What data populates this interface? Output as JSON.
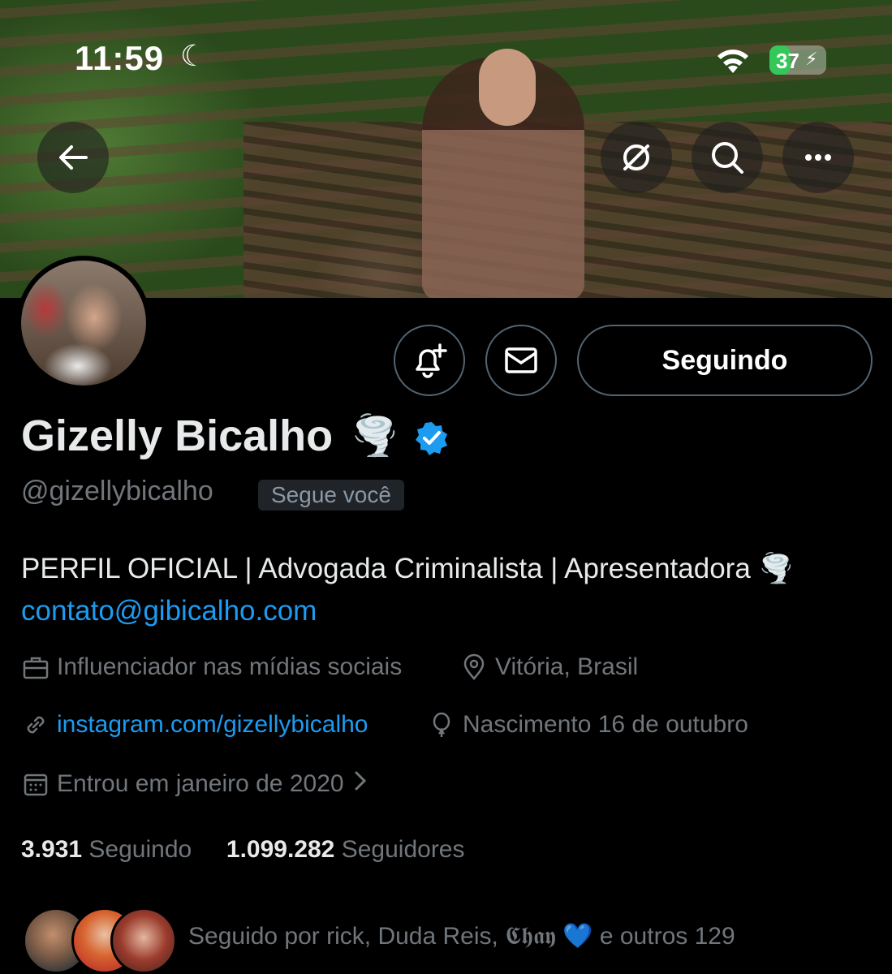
{
  "status_bar": {
    "time": "11:59",
    "battery": "37",
    "battery_level": 0.37
  },
  "header": {
    "back_icon": "arrow-left-icon",
    "hide_icon": "link-off-icon",
    "search_icon": "search-icon",
    "more_icon": "more-horizontal-icon"
  },
  "profile": {
    "name": "Gizelly Bicalho",
    "name_emoji": "🌪️",
    "handle": "@gizellybicalho",
    "follows_you": "Segue você",
    "bio": "PERFIL OFICIAL | Advogada Criminalista | Apresentadora 🌪️",
    "bio_email": "contato@gibicalho.com",
    "category": "Influenciador nas mídias sociais",
    "location": "Vitória, Brasil",
    "website": "instagram.com/gizellybicalho",
    "birthday": "Nascimento 16 de outubro",
    "joined": "Entrou em janeiro de 2020",
    "following_count": "3.931",
    "following_label": "Seguindo",
    "followers_count": "1.099.282",
    "followers_label": "Seguidores",
    "followed_by": "Seguido por rick, Duda Reis, 𝕮𝖍𝖆𝖞 💙 e outros 129"
  },
  "actions": {
    "notify_icon": "bell-plus-icon",
    "message_icon": "mail-icon",
    "follow_label": "Seguindo"
  },
  "colors": {
    "accent": "#1d9bf0",
    "muted": "#71767b",
    "text": "#e7e9ea",
    "battery": "#34c759"
  }
}
